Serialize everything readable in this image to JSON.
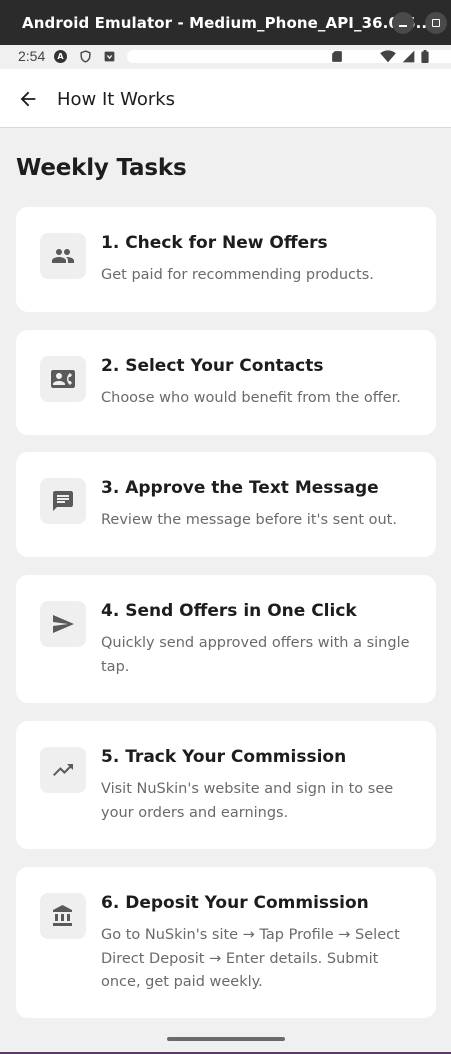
{
  "window": {
    "title": "Android Emulator - Medium_Phone_API_36.0:5..."
  },
  "status_bar": {
    "time": "2:54",
    "icons": [
      "android-auto-icon",
      "shield-icon",
      "download-box-icon",
      "sd-card-icon",
      "wifi-icon",
      "signal-icon",
      "battery-icon"
    ]
  },
  "app_bar": {
    "title": "How It Works"
  },
  "section": {
    "title": "Weekly Tasks"
  },
  "tasks": [
    {
      "title": "1.  Check for New Offers",
      "description": "Get paid for recommending products.",
      "icon": "people-icon"
    },
    {
      "title": "2.  Select Your Contacts",
      "description": "Choose who would benefit from the offer.",
      "icon": "contact-card-icon"
    },
    {
      "title": "3.  Approve the Text Message",
      "description": "Review the message before it's sent out.",
      "icon": "message-icon"
    },
    {
      "title": "4.  Send Offers in One Click",
      "description": "Quickly send approved offers with a single tap.",
      "icon": "send-icon"
    },
    {
      "title": "5.  Track Your Commission",
      "description": "Visit NuSkin's website and sign in to see your orders and earnings.",
      "icon": "trending-up-icon"
    },
    {
      "title": "6.  Deposit Your Commission",
      "description": "Go to NuSkin's site → Tap Profile → Select Direct Deposit → Enter details. Submit once, get paid weekly.",
      "icon": "bank-icon"
    }
  ],
  "colors": {
    "background": "#f0f0f0",
    "card": "#ffffff",
    "icon_tile": "#efefef",
    "icon": "#5a5a5a",
    "title_text": "#1d1d1d",
    "desc_text": "#6a6a6a"
  }
}
